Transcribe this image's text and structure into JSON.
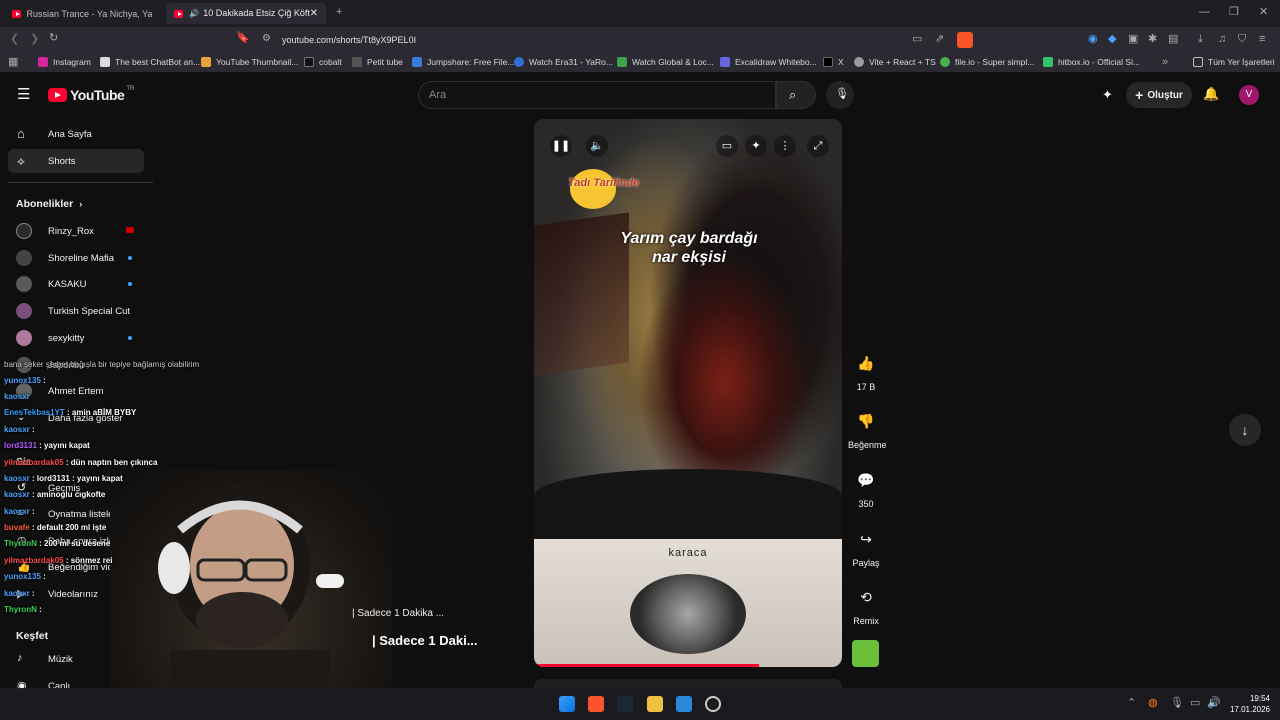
{
  "browser": {
    "tabs": [
      {
        "title": "Russian Trance - Ya Nichya, Ya Chuzh..."
      },
      {
        "title": "10 Dakikada Etsiz Çiğ Köfte 🔥"
      }
    ],
    "url": "youtube.com/shorts/Tt8yX9PEL0I",
    "bookmarks": [
      "Instagram",
      "The best ChatBot an...",
      "YouTube Thumbnail...",
      "cobalt",
      "Petit tube",
      "Jumpshare: Free File...",
      "Watch Era31 - YaRo...",
      "Watch Global & Loc...",
      "Excalidraw Whitebo...",
      "X",
      "Vite + React + TS",
      "file.io - Super simpl...",
      "hitbox.io - Official Si..."
    ],
    "all_bookmarks": "Tüm Yer İşaretleri"
  },
  "youtube": {
    "logo": "YouTube",
    "logo_country": "TR",
    "search_placeholder": "Ara",
    "create_label": "Oluştur",
    "avatar_letter": "V"
  },
  "sidebar": {
    "main": [
      {
        "label": "Ana Sayfa"
      },
      {
        "label": "Shorts"
      }
    ],
    "subs_title": "Abonelikler",
    "subscriptions": [
      {
        "label": "Rinzy_Rox",
        "color": "#2c2c2c"
      },
      {
        "label": "Shoreline Mafia",
        "color": "#444444"
      },
      {
        "label": "KASAKU",
        "color": "#5a5a5a"
      },
      {
        "label": "Turkish Special Cut",
        "color": "#7a4f7a"
      },
      {
        "label": "sexykitty",
        "color": "#b07aa0"
      },
      {
        "label": "Japonbu",
        "color": "#555555"
      },
      {
        "label": "Ahmet Ertem",
        "color": "#666666"
      }
    ],
    "more_label": "Daha fazla göster",
    "you_title": "Siz",
    "you_items": [
      "Geçmiş",
      "Oynatma listeleri",
      "Daha sonra izle",
      "Beğendiğim videolar",
      "Videolarınız"
    ],
    "explore_title": "Keşfet",
    "explore_items": [
      "Müzik",
      "Canlı"
    ]
  },
  "chat": [
    {
      "name": "Japonbu",
      "msg": "bana şeker şerbet bağışla bir tepiye bağlamış olabilirim"
    },
    {
      "name": "yunox135",
      "msg": ":"
    },
    {
      "name": "kaosxr",
      "msg": ""
    },
    {
      "name": "EnesTekbas1YT",
      "msg": ": amin aBİM BYBY"
    },
    {
      "name": "kaosxr",
      "msg": ":"
    },
    {
      "name": "lord3131",
      "msg": ": yayını kapat"
    },
    {
      "name": "yilmazbardak05",
      "msg": ": dün naptın ben çıkınca"
    },
    {
      "name": "kaosxr",
      "msg": ": lord3131 : yayını kapat"
    },
    {
      "name": "kaosxr",
      "msg": ": aminoglu cıgkofte"
    },
    {
      "name": "kaosxr",
      "msg": ":"
    },
    {
      "name": "buvafe",
      "msg": ": default 200 ml işte"
    },
    {
      "name": "ThyronN",
      "msg": ": 200 ml su desene"
    },
    {
      "name": "yilmazbardak05",
      "msg": ": sönmez rei"
    },
    {
      "name": "yunox135",
      "msg": ":"
    },
    {
      "name": "kaosxr",
      "msg": ":"
    },
    {
      "name": "ThyronN",
      "msg": ":"
    }
  ],
  "video": {
    "overlay_line1": "Yarım çay bardağı",
    "overlay_line2": "nar ekşisi",
    "channel_logo": "Tadı Tarifinde",
    "brand": "karaca",
    "progress_fraction": 0.73,
    "title_small": "| Sadece 1 Dakika ...",
    "title_big": "| Sadece 1 Daki..."
  },
  "actions": {
    "like_count": "17 B",
    "dislike_label": "Beğenme",
    "comment_count": "350",
    "share_label": "Paylaş",
    "remix_label": "Remix"
  },
  "taskbar": {
    "time": "19:54",
    "date": "17.01.2026"
  }
}
